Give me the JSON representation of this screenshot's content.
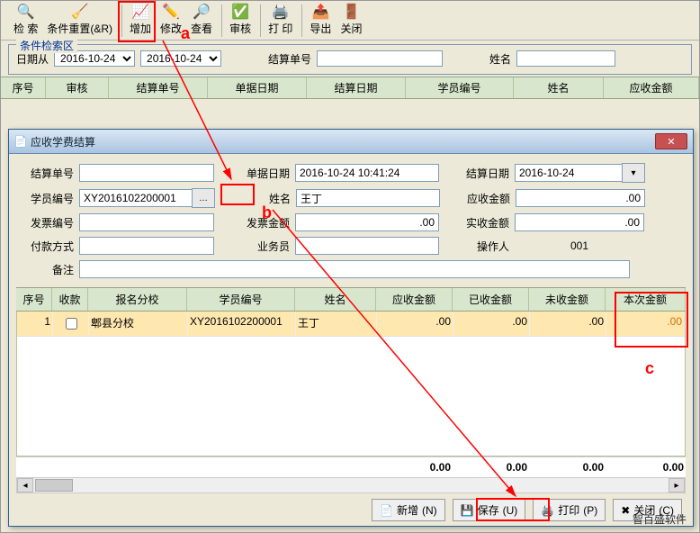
{
  "toolbar": {
    "search": "检 索",
    "reset": "条件重置(&R)",
    "add": "增加",
    "edit": "修改",
    "view": "查看",
    "audit": "审核",
    "print": "打 印",
    "export": "导出",
    "exit": "关闭"
  },
  "anno": {
    "a": "a",
    "b": "b",
    "c": "c"
  },
  "criteria": {
    "title": "条件检索区",
    "date_from_label": "日期从",
    "date_from": "2016-10-24",
    "date_to": "2016-10-24",
    "bill_no_label": "结算单号",
    "bill_no": "",
    "name_label": "姓名",
    "name": ""
  },
  "mainGrid": {
    "cols": [
      "序号",
      "审核",
      "结算单号",
      "单据日期",
      "结算日期",
      "学员编号",
      "姓名",
      "应收金额"
    ]
  },
  "dialog": {
    "title": "应收学费结算",
    "labels": {
      "bill_no": "结算单号",
      "bill_date": "单据日期",
      "settle_date": "结算日期",
      "student_no": "学员编号",
      "name": "姓名",
      "receivable": "应收金额",
      "invoice_no": "发票编号",
      "invoice_amt": "发票金额",
      "received": "实收金额",
      "pay_method": "付款方式",
      "clerk": "业务员",
      "operator": "操作人",
      "remark": "备注"
    },
    "values": {
      "bill_no": "",
      "bill_date": "2016-10-24 10:41:24",
      "settle_date": "2016-10-24",
      "student_no": "XY2016102200001",
      "name": "王丁",
      "receivable": ".00",
      "invoice_no": "",
      "invoice_amt": ".00",
      "received": ".00",
      "pay_method": "",
      "clerk": "",
      "operator": "001",
      "remark": ""
    },
    "gridCols": [
      "序号",
      "收款",
      "报名分校",
      "学员编号",
      "姓名",
      "应收金额",
      "已收金额",
      "未收金额",
      "本次金额"
    ],
    "rows": [
      {
        "seq": "1",
        "chk": false,
        "branch": "郫县分校",
        "student": "XY2016102200001",
        "name": "王丁",
        "receivable": ".00",
        "received": ".00",
        "unreceived": ".00",
        "current": ".00"
      }
    ],
    "sums": {
      "receivable": "0.00",
      "received": "0.00",
      "unreceived": "0.00",
      "current": "0.00"
    },
    "footer": {
      "new": "新增",
      "save": "保存",
      "print": "打印",
      "close": "关闭",
      "newKey": "(N)",
      "saveKey": "(U)",
      "printKey": "(P)",
      "closeKey": "(C)"
    }
  },
  "brand": "智百盛软件"
}
